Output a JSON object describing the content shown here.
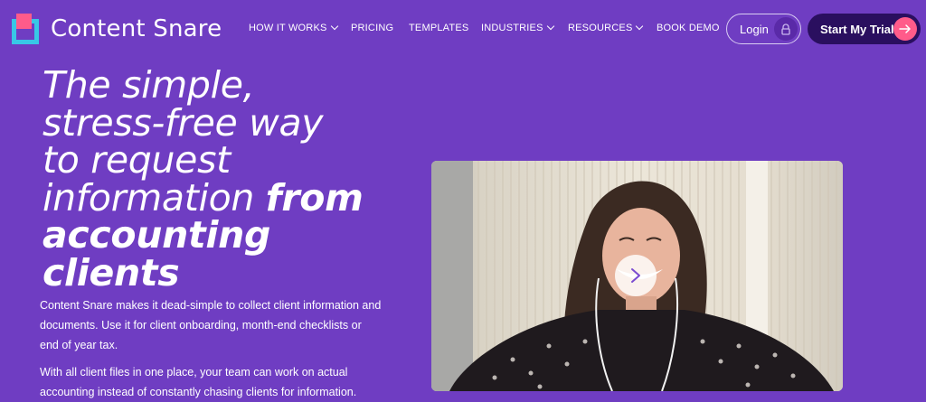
{
  "header": {
    "brand": "Content Snare",
    "nav": [
      {
        "label": "HOW IT WORKS",
        "dropdown": true
      },
      {
        "label": "PRICING",
        "dropdown": false
      },
      {
        "label": "TEMPLATES",
        "dropdown": false
      },
      {
        "label": "INDUSTRIES",
        "dropdown": true
      },
      {
        "label": "RESOURCES",
        "dropdown": true
      },
      {
        "label": "BOOK DEMO",
        "dropdown": false
      }
    ],
    "login_label": "Login",
    "trial_label": "Start My Trial"
  },
  "hero": {
    "title_lines": [
      "The simple,",
      "stress-free way",
      "to request",
      "information ",
      "from",
      "accounting",
      "clients"
    ],
    "paragraph_1": "Content Snare makes it dead-simple to collect client information and documents. Use it for client onboarding, month-end checklists or end of year tax.",
    "paragraph_2": "With all client files in one place, your team can work on actual accounting instead of constantly chasing clients for information."
  },
  "video": {
    "play_icon": "play-icon"
  },
  "colors": {
    "background": "#6f3dc2",
    "trial_button": "#2a0f5f",
    "accent_pink": "#ff5b8a",
    "accent_cyan": "#38c7e6"
  }
}
